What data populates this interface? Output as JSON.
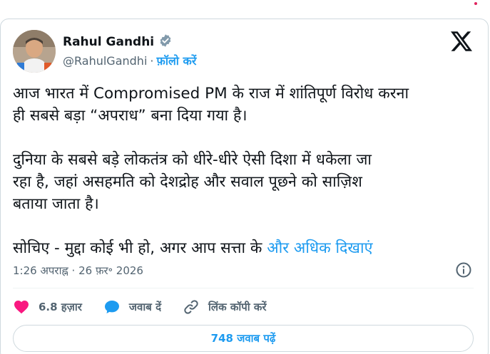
{
  "colors": {
    "accent": "#1d9bf0",
    "text": "#0f1419",
    "muted": "#536471",
    "like": "#f91880",
    "border": "#cfd9de"
  },
  "author": {
    "name": "Rahul Gandhi",
    "handle": "@RahulGandhi",
    "separator": "·",
    "follow_label": "फ़ॉलो करें",
    "verified_icon": "verified-badge-icon",
    "logo_icon": "x-logo-icon"
  },
  "tweet": {
    "para1_line1": "आज भारत में Compromised PM के राज में शांतिपूर्ण विरोध करना",
    "para1_line2": "ही सबसे बड़ा “अपराध” बना दिया गया है।",
    "para2_line1": "दुनिया के सबसे बड़े लोकतंत्र को धीरे-धीरे ऐसी दिशा में धकेला जा",
    "para2_line2": "रहा है, जहां असहमति को देशद्रोह और सवाल पूछने को साज़िश",
    "para2_line3": "बताया जाता है।",
    "para3_text": "सोचिए - मुद्दा कोई भी हो, अगर आप सत्ता के ",
    "show_more": "और अधिक दिखाएं"
  },
  "meta": {
    "timestamp": "1:26 अपराह्न · 26 फ़र॰ 2026",
    "info_icon": "info-icon"
  },
  "actions": {
    "likes": "6.8 हज़ार",
    "reply": "जवाब दें",
    "copy_link": "लिंक कॉपी करें"
  },
  "replies_button": "748 जवाब पढ़ें"
}
